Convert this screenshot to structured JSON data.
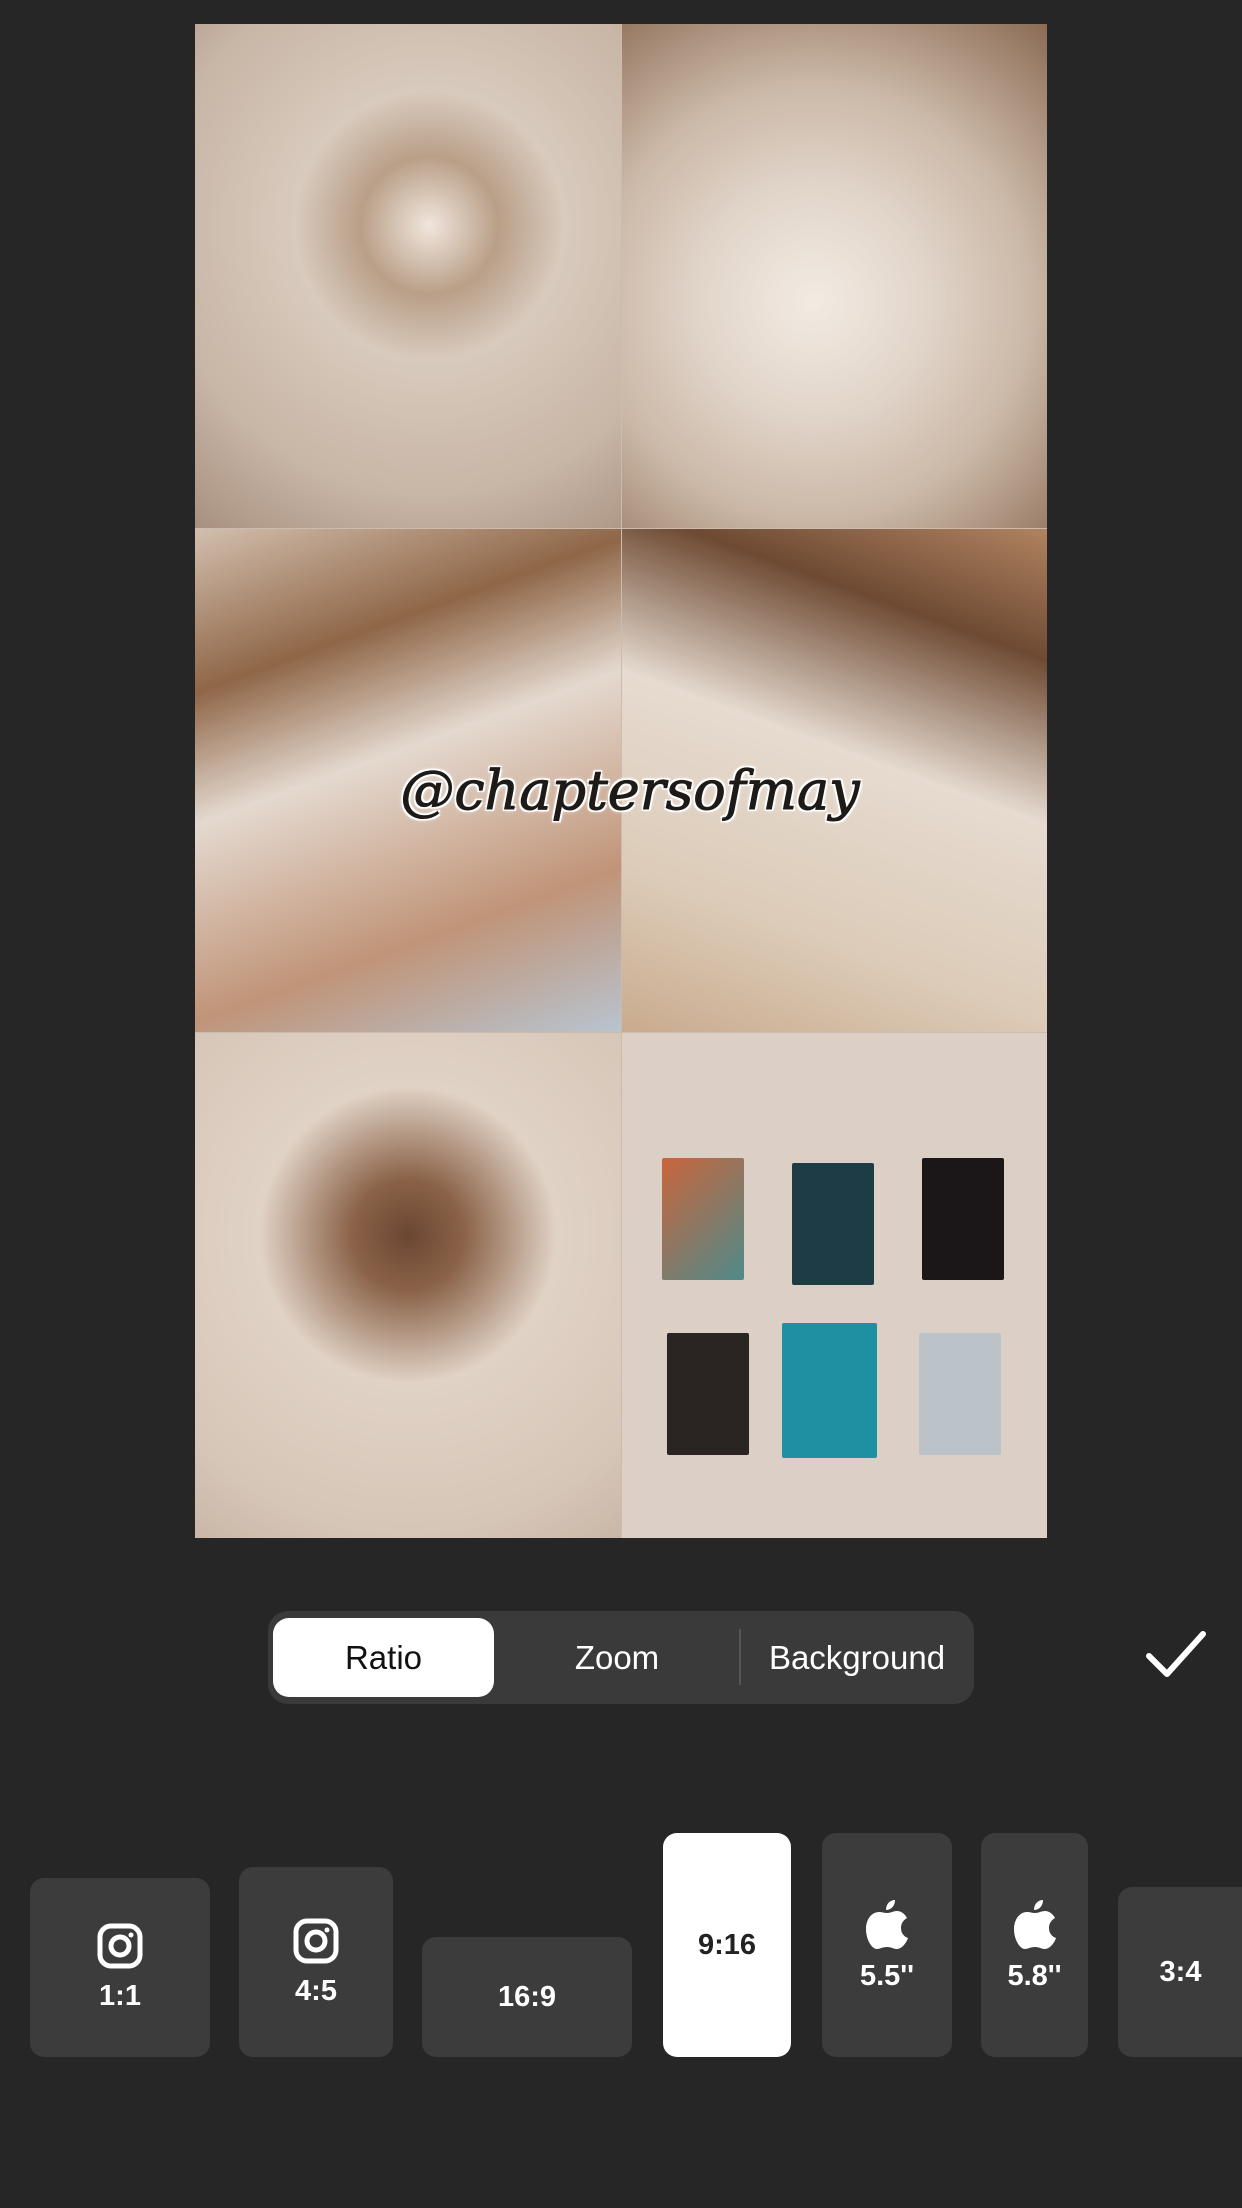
{
  "canvas": {
    "watermark": "@chaptersofmay",
    "photo_count": 6
  },
  "segmented": {
    "tabs": [
      {
        "label": "Ratio",
        "selected": true
      },
      {
        "label": "Zoom",
        "selected": false
      },
      {
        "label": "Background",
        "selected": false
      }
    ]
  },
  "confirm": {
    "icon": "checkmark-icon"
  },
  "ratios": [
    {
      "label": "1:1",
      "icon": "instagram-icon",
      "selected": false
    },
    {
      "label": "4:5",
      "icon": "instagram-icon",
      "selected": false
    },
    {
      "label": "16:9",
      "icon": null,
      "selected": false
    },
    {
      "label": "9:16",
      "icon": null,
      "selected": true
    },
    {
      "label": "5.5''",
      "icon": "apple-icon",
      "selected": false
    },
    {
      "label": "5.8''",
      "icon": "apple-icon",
      "selected": false
    },
    {
      "label": "3:4",
      "icon": null,
      "selected": false
    }
  ],
  "colors": {
    "background": "#262626",
    "tile": "#3c3c3c",
    "selected": "#ffffff",
    "segment": "#3a3a3a"
  }
}
